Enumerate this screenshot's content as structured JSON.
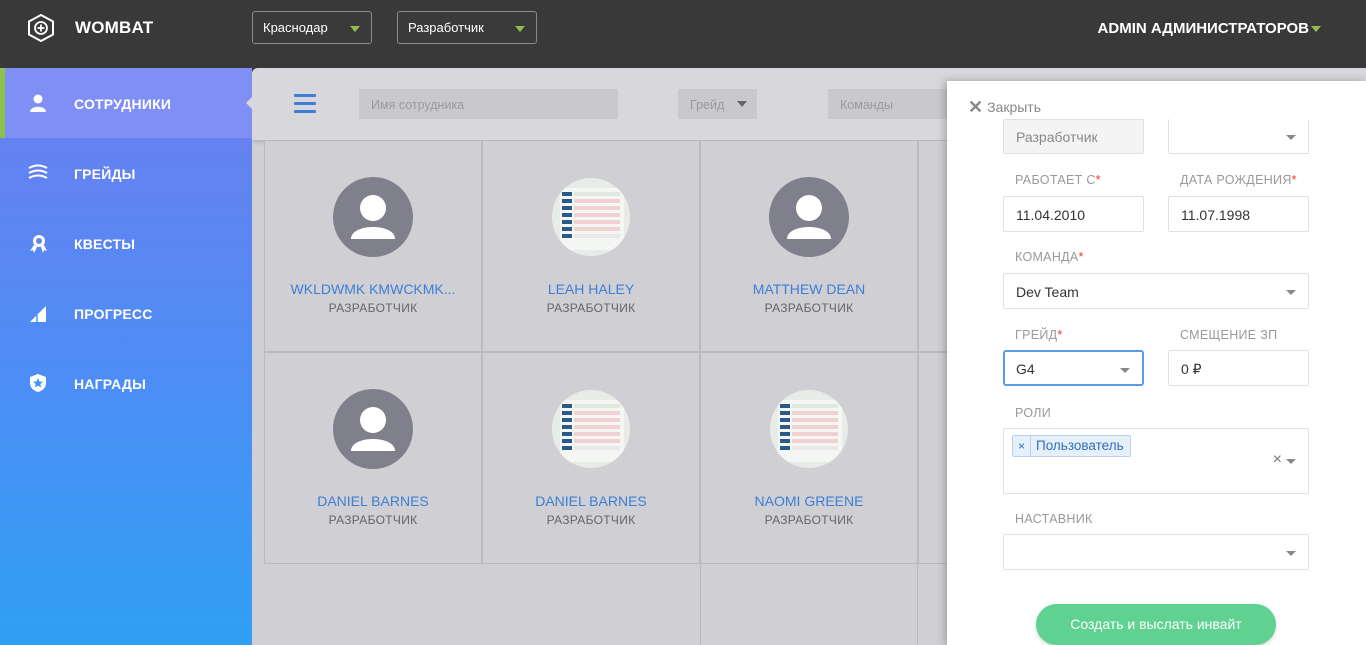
{
  "header": {
    "app_name": "WOMBAT",
    "city_select": "Краснодар",
    "role_select": "Разработчик",
    "user_name": "ADMIN АДМИНИСТРАТОРОВ"
  },
  "sidebar": {
    "items": [
      {
        "label": "СОТРУДНИКИ",
        "icon": "user-icon",
        "active": true
      },
      {
        "label": "ГРЕЙДЫ",
        "icon": "layers-icon",
        "active": false
      },
      {
        "label": "КВЕСТЫ",
        "icon": "medal-icon",
        "active": false
      },
      {
        "label": "ПРОГРЕСС",
        "icon": "signal-icon",
        "active": false
      },
      {
        "label": "НАГРАДЫ",
        "icon": "star-badge-icon",
        "active": false
      }
    ]
  },
  "filters": {
    "name_placeholder": "Имя сотрудника",
    "grade_placeholder": "Грейд",
    "teams_placeholder": "Команды"
  },
  "employees": [
    {
      "name": "WKLDWMK KMWCKMK...",
      "role": "РАЗРАБОТЧИК",
      "avatar": "default"
    },
    {
      "name": "LEAH HALEY",
      "role": "РАЗРАБОТЧИК",
      "avatar": "screenshot"
    },
    {
      "name": "MATTHEW DEAN",
      "role": "РАЗРАБОТЧИК",
      "avatar": "default"
    },
    {
      "name": "DANIEL BARNES",
      "role": "РАЗРАБОТЧИК",
      "avatar": "default"
    },
    {
      "name": "DANIEL BARNES",
      "role": "РАЗРАБОТЧИК",
      "avatar": "screenshot"
    },
    {
      "name": "NAOMI GREENE",
      "role": "РАЗРАБОТЧИК",
      "avatar": "screenshot"
    }
  ],
  "panel": {
    "close_label": "Закрыть",
    "position_value": "Разработчик",
    "works_since_label": "РАБОТАЕТ С",
    "works_since_value": "11.04.2010",
    "birth_date_label": "ДАТА РОЖДЕНИЯ",
    "birth_date_value": "11.07.1998",
    "team_label": "КОМАНДА",
    "team_value": "Dev Team",
    "grade_label": "ГРЕЙД",
    "grade_value": "G4",
    "salary_offset_label": "СМЕЩЕНИЕ ЗП",
    "salary_offset_value": "0 ₽",
    "roles_label": "РОЛИ",
    "role_tag": "Пользователь",
    "mentor_label": "НАСТАВНИК",
    "submit_label": "Создать и выслать инвайт",
    "required_mark": "*"
  },
  "colors": {
    "accent_green": "#8bc34a",
    "link_blue": "#3d7ed6",
    "submit_green": "#5fd291",
    "required_red": "#e53935"
  }
}
